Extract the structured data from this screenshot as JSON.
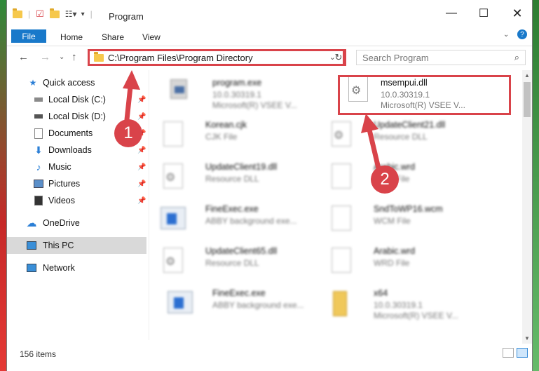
{
  "window": {
    "title": "Program"
  },
  "ribbon": {
    "tabs": [
      "File",
      "Home",
      "Share",
      "View"
    ]
  },
  "address": {
    "path": "C:\\Program Files\\Program Directory"
  },
  "search": {
    "placeholder": "Search Program"
  },
  "sidebar": {
    "items": [
      {
        "label": "Quick access",
        "icon": "star-icon",
        "pinned": false
      },
      {
        "label": "Local Disk (C:)",
        "icon": "drive-icon",
        "pinned": true
      },
      {
        "label": "Local Disk (D:)",
        "icon": "drive-icon",
        "pinned": true
      },
      {
        "label": "Documents",
        "icon": "documents-icon",
        "pinned": true
      },
      {
        "label": "Downloads",
        "icon": "download-icon",
        "pinned": true
      },
      {
        "label": "Music",
        "icon": "music-icon",
        "pinned": true
      },
      {
        "label": "Pictures",
        "icon": "pictures-icon",
        "pinned": true
      },
      {
        "label": "Videos",
        "icon": "videos-icon",
        "pinned": true
      },
      {
        "label": "OneDrive",
        "icon": "cloud-icon",
        "pinned": false
      },
      {
        "label": "This PC",
        "icon": "computer-icon",
        "pinned": false,
        "selected": true
      },
      {
        "label": "Network",
        "icon": "network-icon",
        "pinned": false
      }
    ]
  },
  "files": [
    {
      "name": "program.exe",
      "line2": "10.0.30319.1",
      "line3": "Microsoft(R) VSEE V...",
      "icon": "exe-icon"
    },
    {
      "name": "msempui.dll",
      "line2": "10.0.30319.1",
      "line3": "Microsoft(R) VSEE V...",
      "icon": "dll-gear-icon"
    },
    {
      "name": "Korean.cjk",
      "line2": "CJK File",
      "line3": "",
      "icon": "doc-icon"
    },
    {
      "name": "UpdateClient21.dll",
      "line2": "Resource DLL",
      "line3": "",
      "icon": "dll-gear-icon"
    },
    {
      "name": "UpdateClient19.dll",
      "line2": "Resource DLL",
      "line3": "",
      "icon": "dll-gear-icon"
    },
    {
      "name": "Arabic.wrd",
      "line2": "WRD File",
      "line3": "",
      "icon": "doc-icon"
    },
    {
      "name": "FineExec.exe",
      "line2": "ABBY background exe...",
      "line3": "",
      "icon": "app-window-icon"
    },
    {
      "name": "SndToWP16.wcm",
      "line2": "WCM File",
      "line3": "",
      "icon": "doc-icon"
    },
    {
      "name": "UpdateClient65.dll",
      "line2": "Resource DLL",
      "line3": "",
      "icon": "dll-gear-icon"
    },
    {
      "name": "Arabic.wrd",
      "line2": "WRD File",
      "line3": "",
      "icon": "doc-icon"
    },
    {
      "name": "FineExec.exe",
      "line2": "ABBY background exe...",
      "line3": "",
      "icon": "app-window-icon"
    },
    {
      "name": "x64",
      "line2": "10.0.30319.1",
      "line3": "Microsoft(R) VSEE V...",
      "icon": "folder-icon"
    }
  ],
  "status": {
    "items_count": "156 items"
  },
  "annotations": {
    "step1": "1",
    "step2": "2",
    "color": "#d9434a"
  }
}
